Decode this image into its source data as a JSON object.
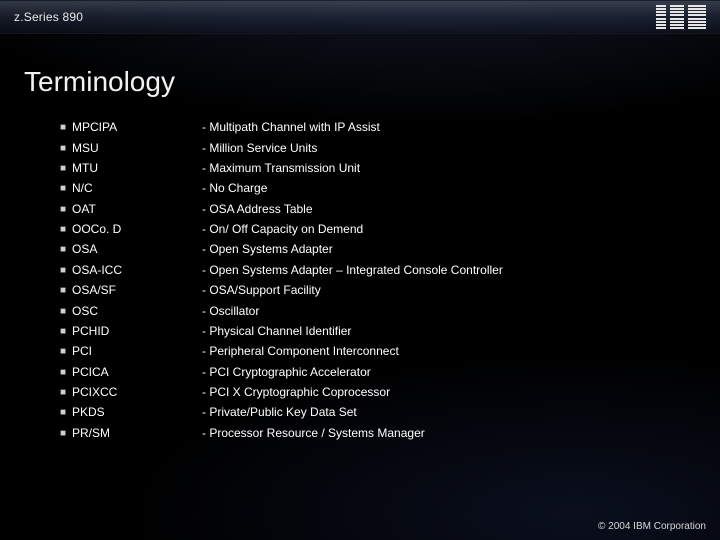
{
  "header": {
    "product": "z.Series 890",
    "logo_alt": "IBM"
  },
  "title": "Terminology",
  "terms": [
    {
      "abbr": "MPCIPA",
      "definition": "- Multipath Channel with IP Assist"
    },
    {
      "abbr": "MSU",
      "definition": "- Million Service Units"
    },
    {
      "abbr": "MTU",
      "definition": "- Maximum Transmission Unit"
    },
    {
      "abbr": "N/C",
      "definition": "- No Charge"
    },
    {
      "abbr": "OAT",
      "definition": "- OSA Address Table"
    },
    {
      "abbr": "OOCo. D",
      "definition": "- On/ Off Capacity on Demend"
    },
    {
      "abbr": "OSA",
      "definition": "- Open Systems Adapter"
    },
    {
      "abbr": "OSA-ICC",
      "definition": "- Open Systems Adapter – Integrated Console Controller"
    },
    {
      "abbr": "OSA/SF",
      "definition": "- OSA/Support Facility"
    },
    {
      "abbr": "OSC",
      "definition": "- Oscillator"
    },
    {
      "abbr": "PCHID",
      "definition": "- Physical Channel Identifier"
    },
    {
      "abbr": "PCI",
      "definition": "- Peripheral Component Interconnect"
    },
    {
      "abbr": "PCICA",
      "definition": "- PCI Cryptographic Accelerator"
    },
    {
      "abbr": "PCIXCC",
      "definition": "- PCI X Cryptographic Coprocessor"
    },
    {
      "abbr": "PKDS",
      "definition": "- Private/Public Key Data Set"
    },
    {
      "abbr": "PR/SM",
      "definition": "- Processor Resource / Systems Manager"
    }
  ],
  "footer": {
    "copyright": "© 2004 IBM Corporation"
  }
}
